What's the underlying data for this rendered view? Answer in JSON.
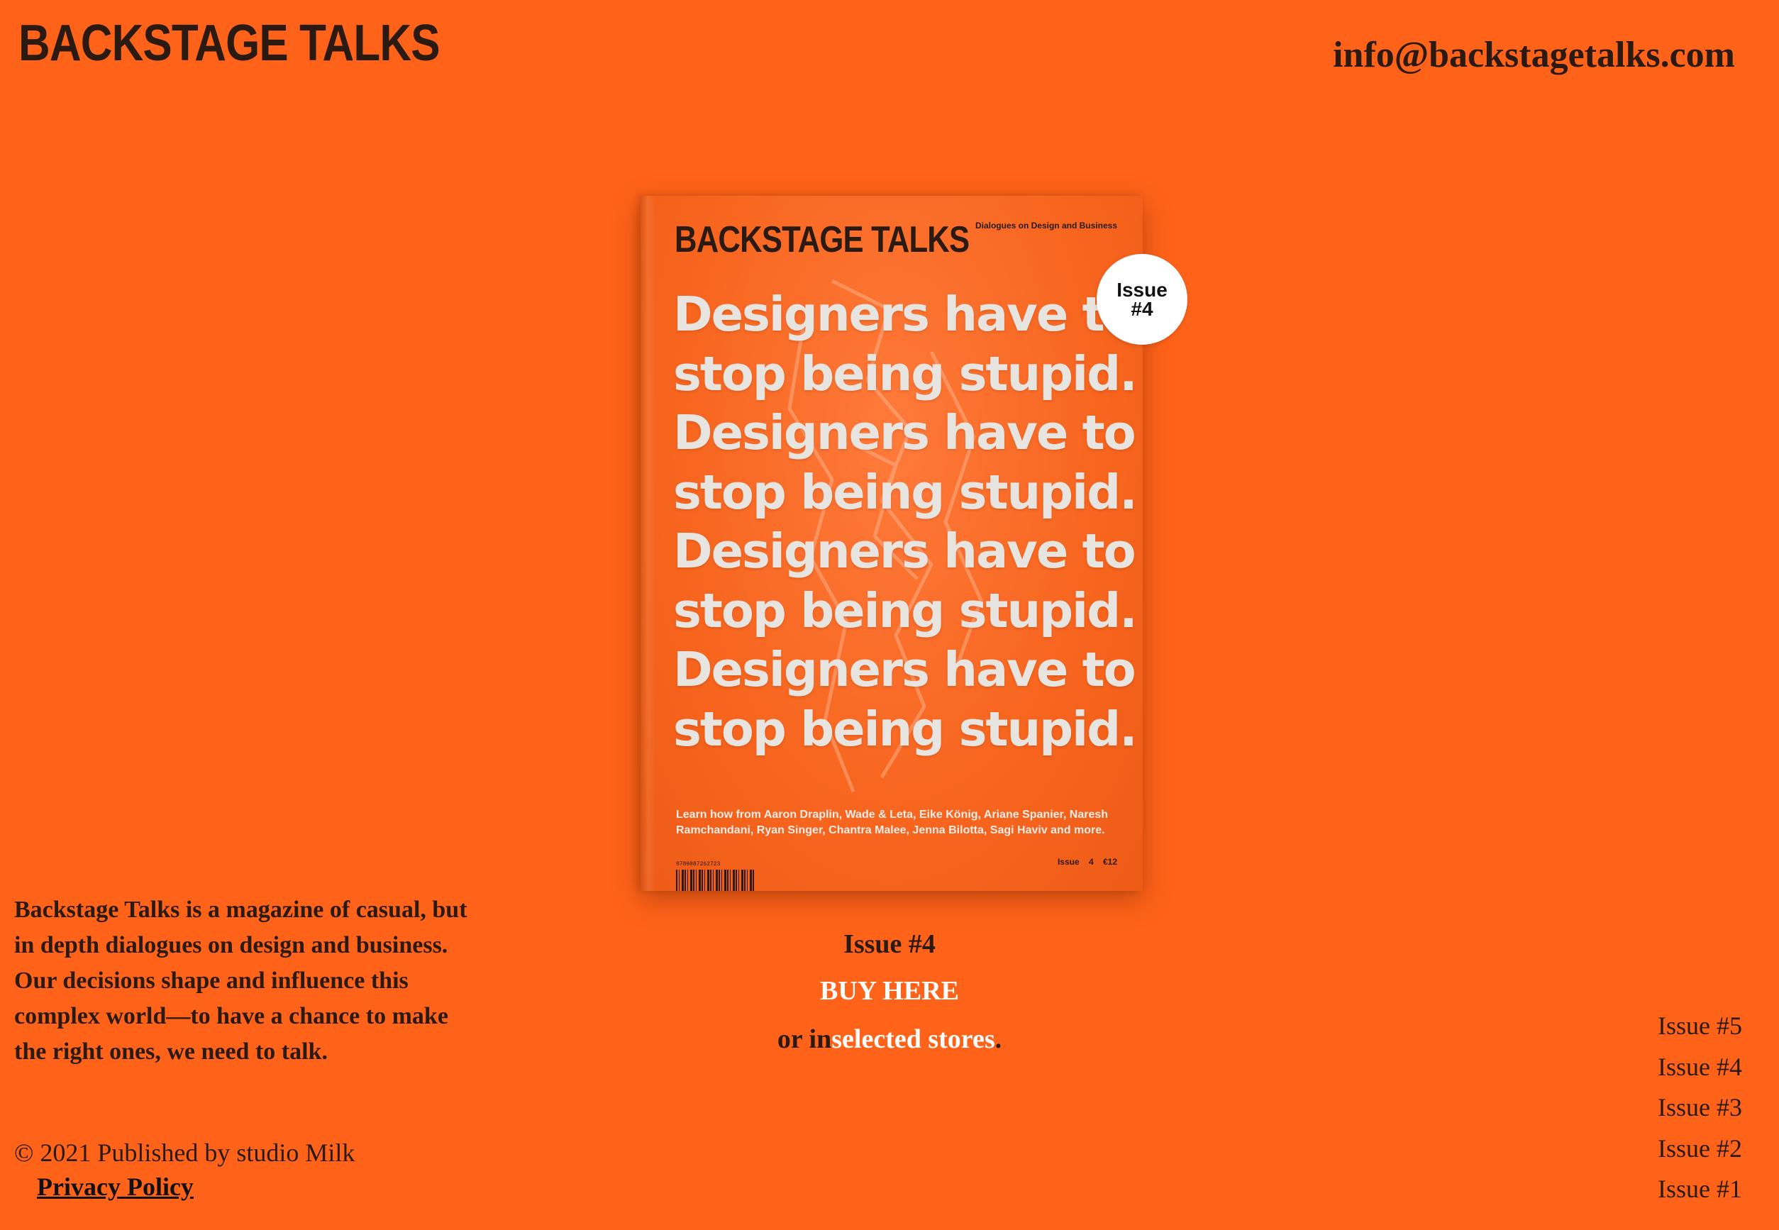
{
  "header": {
    "logo": "BACKSTAGE TALKS",
    "email": "info@backstagetalks.com"
  },
  "cover": {
    "logo": "BACKSTAGE TALKS",
    "tagline": "Dialogues on Design and Business",
    "headline_lines": [
      "Designers have to",
      "stop being stupid.",
      "Designers have to",
      "stop being stupid.",
      "Designers have to",
      "stop being stupid.",
      "Designers have to",
      "stop being stupid."
    ],
    "blurb": "Learn how from Aaron Draplin, Wade & Leta, Eike König, Ariane Spanier, Naresh Ramchandani, Ryan Singer, Chantra Malee, Jenna Bilotta, Sagi Haviv and more.",
    "isbn": "9789887262723",
    "issue_price": "Issue 4  €12",
    "badge": "Issue\n#4"
  },
  "buy": {
    "issue": "Issue #4",
    "buy_label": "BUY HERE",
    "or_text": "or in",
    "stores_label": "selected stores",
    "period": "."
  },
  "about": "Backstage Talks is a magazine of casual, but in depth dialogues on design and business. Our decisions shape and influence this complex world—to have a chance to make the right ones, we need to talk.",
  "footer": {
    "copyright": "© 2021 Published by studio Milk",
    "privacy": "Privacy Policy"
  },
  "issue_nav": [
    "Issue #5",
    "Issue #4",
    "Issue #3",
    "Issue #2",
    "Issue #1"
  ],
  "colors": {
    "background": "#ff6319",
    "text_dark": "#2a1a12",
    "link_white": "#ffffff"
  }
}
